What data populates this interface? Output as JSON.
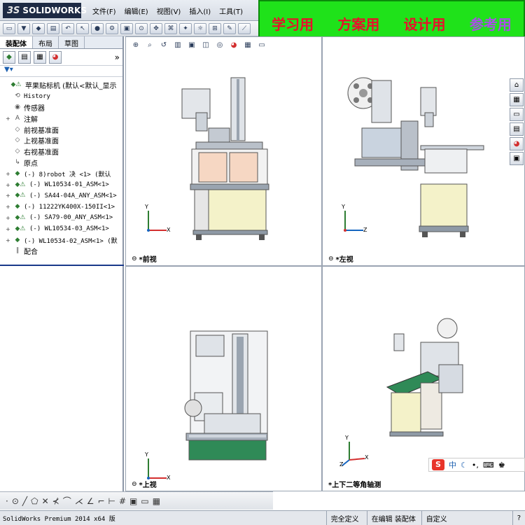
{
  "app": {
    "logo": "SOLIDWORKS",
    "logo_prefix": "3S",
    "menus": [
      "文件(F)",
      "编辑(E)",
      "视图(V)",
      "插入(I)",
      "工具(T)"
    ]
  },
  "banner": {
    "items": [
      "学习用",
      "方案用",
      "设计用",
      "参考用"
    ]
  },
  "toolbar": {
    "buttons": [
      "new",
      "open",
      "save",
      "print",
      "undo",
      "select",
      "rebuild",
      "options",
      "assembly",
      "mate",
      "move",
      "smart",
      "explode",
      "lights",
      "snap",
      "sketch"
    ]
  },
  "left_panel": {
    "tabs": [
      "装配体",
      "布局",
      "草图"
    ],
    "tree": [
      {
        "label": "苹果贴标机  (默认<默认_显示",
        "icon": "assembly-warn",
        "expand": "",
        "indent": 0,
        "mono": false
      },
      {
        "label": "History",
        "icon": "history",
        "expand": "",
        "indent": 1,
        "mono": true
      },
      {
        "label": "传感器",
        "icon": "sensor",
        "expand": "",
        "indent": 1,
        "mono": false
      },
      {
        "label": "注解",
        "icon": "annotation",
        "expand": "+",
        "indent": 1,
        "mono": false
      },
      {
        "label": "前视基准面",
        "icon": "plane",
        "expand": "",
        "indent": 1,
        "mono": false
      },
      {
        "label": "上视基准面",
        "icon": "plane",
        "expand": "",
        "indent": 1,
        "mono": false
      },
      {
        "label": "右视基准面",
        "icon": "plane",
        "expand": "",
        "indent": 1,
        "mono": false
      },
      {
        "label": "原点",
        "icon": "origin",
        "expand": "",
        "indent": 1,
        "mono": false
      },
      {
        "label": "(-) 8)robot 决 <1> (默认",
        "icon": "part",
        "expand": "+",
        "indent": 1,
        "mono": true
      },
      {
        "label": "(-) WL10534-01_ASM<1>",
        "icon": "assembly-warn",
        "expand": "+",
        "indent": 1,
        "mono": true
      },
      {
        "label": "(-) SA44-04A_ANY_ASM<1>",
        "icon": "assembly-warn",
        "expand": "+",
        "indent": 1,
        "mono": true
      },
      {
        "label": "(-) 11222YK400X-150II<1>",
        "icon": "assembly",
        "expand": "+",
        "indent": 1,
        "mono": true
      },
      {
        "label": "(-) SA79-00_ANY_ASM<1>",
        "icon": "assembly-warn",
        "expand": "+",
        "indent": 1,
        "mono": true
      },
      {
        "label": "(-) WL10534-03_ASM<1>",
        "icon": "assembly-warn",
        "expand": "+",
        "indent": 1,
        "mono": true
      },
      {
        "label": "(-) WL10534-02_ASM<1> (默",
        "icon": "assembly",
        "expand": "+",
        "indent": 1,
        "mono": true
      },
      {
        "label": "配合",
        "icon": "mates",
        "expand": "",
        "indent": 1,
        "mono": false
      }
    ]
  },
  "viewports": {
    "front": "*前视",
    "left": "*左视",
    "top": "*上视",
    "iso": "*上下二等角轴测"
  },
  "axes": {
    "x": "X",
    "y": "Y",
    "z": "Z"
  },
  "statusbar": {
    "version": "SolidWorks Premium 2014 x64 版",
    "underdefined": "完全定义",
    "editing": "在编辑 装配体",
    "custom": "自定义",
    "help": "?"
  },
  "ime": {
    "logo": "S",
    "mode": "中"
  }
}
